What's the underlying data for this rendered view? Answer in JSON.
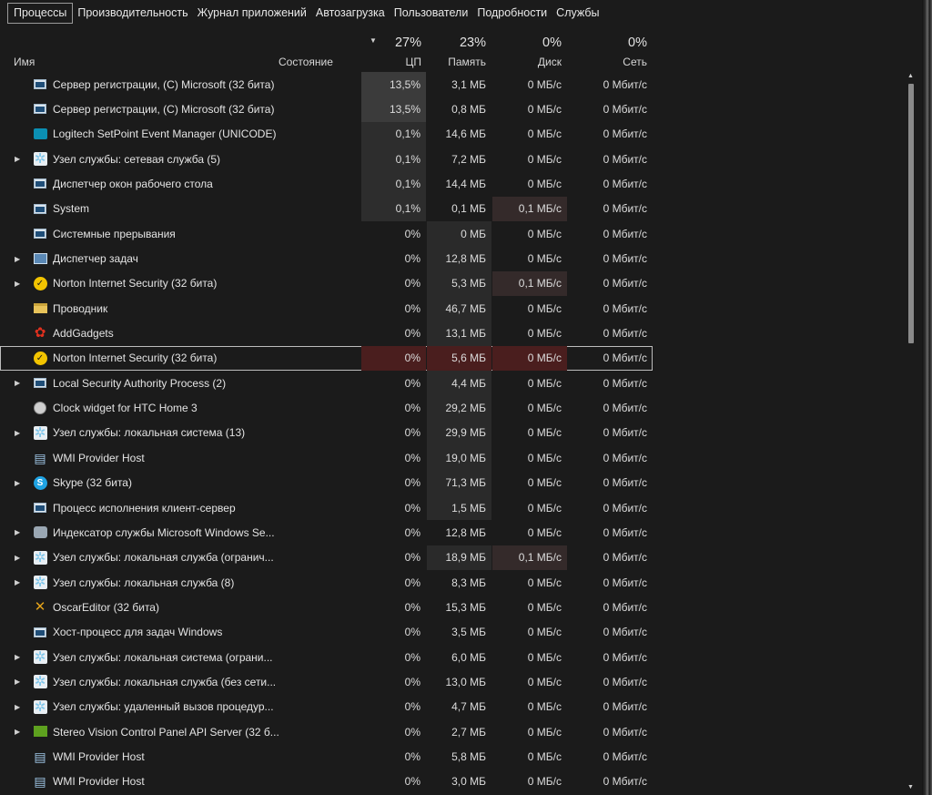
{
  "tabs": [
    "Процессы",
    "Производительность",
    "Журнал приложений",
    "Автозагрузка",
    "Пользователи",
    "Подробности",
    "Службы"
  ],
  "columns": {
    "name": "Имя",
    "status": "Состояние",
    "cpu": {
      "pct": "27%",
      "label": "ЦП"
    },
    "mem": {
      "pct": "23%",
      "label": "Память"
    },
    "disk": {
      "pct": "0%",
      "label": "Диск"
    },
    "net": {
      "pct": "0%",
      "label": "Сеть"
    }
  },
  "rows": [
    {
      "name": "Сервер регистрации, (C) Microsoft (32 бита)",
      "icon": "window-icon",
      "expand": false,
      "cpu": "13,5%",
      "mem": "3,1 МБ",
      "disk": "0 МБ/с",
      "net": "0 Мбит/с"
    },
    {
      "name": "Сервер регистрации, (C) Microsoft (32 бита)",
      "icon": "window-icon",
      "expand": false,
      "cpu": "13,5%",
      "mem": "0,8 МБ",
      "disk": "0 МБ/с",
      "net": "0 Мбит/с"
    },
    {
      "name": "Logitech SetPoint Event Manager (UNICODE)",
      "icon": "logitech-icon",
      "expand": false,
      "cpu": "0,1%",
      "mem": "14,6 МБ",
      "disk": "0 МБ/с",
      "net": "0 Мбит/с"
    },
    {
      "name": "Узел службы: сетевая служба (5)",
      "icon": "gear-icon",
      "expand": true,
      "cpu": "0,1%",
      "mem": "7,2 МБ",
      "disk": "0 МБ/с",
      "net": "0 Мбит/с"
    },
    {
      "name": "Диспетчер окон рабочего стола",
      "icon": "window-icon",
      "expand": false,
      "cpu": "0,1%",
      "mem": "14,4 МБ",
      "disk": "0 МБ/с",
      "net": "0 Мбит/с"
    },
    {
      "name": "System",
      "icon": "window-icon",
      "expand": false,
      "cpu": "0,1%",
      "mem": "0,1 МБ",
      "disk": "0,1 МБ/с",
      "net": "0 Мбит/с"
    },
    {
      "name": "Системные прерывания",
      "icon": "window-icon",
      "expand": false,
      "cpu": "0%",
      "mem": "0 МБ",
      "disk": "0 МБ/с",
      "net": "0 Мбит/с"
    },
    {
      "name": "Диспетчер задач",
      "icon": "task-manager-icon",
      "expand": true,
      "cpu": "0%",
      "mem": "12,8 МБ",
      "disk": "0 МБ/с",
      "net": "0 Мбит/с"
    },
    {
      "name": "Norton Internet Security (32 бита)",
      "icon": "norton-icon",
      "expand": true,
      "cpu": "0%",
      "mem": "5,3 МБ",
      "disk": "0,1 МБ/с",
      "net": "0 Мбит/с"
    },
    {
      "name": "Проводник",
      "icon": "folder-icon",
      "expand": false,
      "cpu": "0%",
      "mem": "46,7 МБ",
      "disk": "0 МБ/с",
      "net": "0 Мбит/с"
    },
    {
      "name": "AddGadgets",
      "icon": "huawei-icon",
      "expand": false,
      "cpu": "0%",
      "mem": "13,1 МБ",
      "disk": "0 МБ/с",
      "net": "0 Мбит/с"
    },
    {
      "name": "Norton Internet Security (32 бита)",
      "icon": "norton-icon",
      "expand": false,
      "cpu": "0%",
      "mem": "5,6 МБ",
      "disk": "0 МБ/с",
      "net": "0 Мбит/с",
      "selected": true
    },
    {
      "name": "Local Security Authority Process (2)",
      "icon": "window-icon",
      "expand": true,
      "cpu": "0%",
      "mem": "4,4 МБ",
      "disk": "0 МБ/с",
      "net": "0 Мбит/с"
    },
    {
      "name": "Clock widget for HTC Home 3",
      "icon": "clock-icon",
      "expand": false,
      "cpu": "0%",
      "mem": "29,2 МБ",
      "disk": "0 МБ/с",
      "net": "0 Мбит/с"
    },
    {
      "name": "Узел службы: локальная система (13)",
      "icon": "gear-icon",
      "expand": true,
      "cpu": "0%",
      "mem": "29,9 МБ",
      "disk": "0 МБ/с",
      "net": "0 Мбит/с"
    },
    {
      "name": "WMI Provider Host",
      "icon": "wmi-icon",
      "expand": false,
      "cpu": "0%",
      "mem": "19,0 МБ",
      "disk": "0 МБ/с",
      "net": "0 Мбит/с"
    },
    {
      "name": "Skype (32 бита)",
      "icon": "skype-icon",
      "expand": true,
      "cpu": "0%",
      "mem": "71,3 МБ",
      "disk": "0 МБ/с",
      "net": "0 Мбит/с"
    },
    {
      "name": "Процесс исполнения клиент-сервер",
      "icon": "window-icon",
      "expand": false,
      "cpu": "0%",
      "mem": "1,5 МБ",
      "disk": "0 МБ/с",
      "net": "0 Мбит/с"
    },
    {
      "name": "Индексатор службы Microsoft Windows Se...",
      "icon": "indexer-icon",
      "expand": true,
      "cpu": "0%",
      "mem": "12,8 МБ",
      "disk": "0 МБ/с",
      "net": "0 Мбит/с"
    },
    {
      "name": "Узел службы: локальная служба (огранич...",
      "icon": "gear-icon",
      "expand": true,
      "cpu": "0%",
      "mem": "18,9 МБ",
      "disk": "0,1 МБ/с",
      "net": "0 Мбит/с"
    },
    {
      "name": "Узел службы: локальная служба (8)",
      "icon": "gear-icon",
      "expand": true,
      "cpu": "0%",
      "mem": "8,3 МБ",
      "disk": "0 МБ/с",
      "net": "0 Мбит/с"
    },
    {
      "name": "OscarEditor (32 бита)",
      "icon": "oscar-icon",
      "expand": false,
      "cpu": "0%",
      "mem": "15,3 МБ",
      "disk": "0 МБ/с",
      "net": "0 Мбит/с"
    },
    {
      "name": "Хост-процесс для задач Windows",
      "icon": "window-icon",
      "expand": false,
      "cpu": "0%",
      "mem": "3,5 МБ",
      "disk": "0 МБ/с",
      "net": "0 Мбит/с"
    },
    {
      "name": "Узел службы: локальная система (ограни...",
      "icon": "gear-icon",
      "expand": true,
      "cpu": "0%",
      "mem": "6,0 МБ",
      "disk": "0 МБ/с",
      "net": "0 Мбит/с"
    },
    {
      "name": "Узел службы: локальная служба (без сети...",
      "icon": "gear-icon",
      "expand": true,
      "cpu": "0%",
      "mem": "13,0 МБ",
      "disk": "0 МБ/с",
      "net": "0 Мбит/с"
    },
    {
      "name": "Узел службы: удаленный вызов процедур...",
      "icon": "gear-icon",
      "expand": true,
      "cpu": "0%",
      "mem": "4,7 МБ",
      "disk": "0 МБ/с",
      "net": "0 Мбит/с"
    },
    {
      "name": "Stereo Vision Control Panel API Server (32 б...",
      "icon": "nvidia-icon",
      "expand": true,
      "cpu": "0%",
      "mem": "2,7 МБ",
      "disk": "0 МБ/с",
      "net": "0 Мбит/с"
    },
    {
      "name": "WMI Provider Host",
      "icon": "wmi-icon",
      "expand": false,
      "cpu": "0%",
      "mem": "5,8 МБ",
      "disk": "0 МБ/с",
      "net": "0 Мбит/с"
    },
    {
      "name": "WMI Provider Host",
      "icon": "wmi-icon",
      "expand": false,
      "cpu": "0%",
      "mem": "3,0 МБ",
      "disk": "0 МБ/с",
      "net": "0 Мбит/с"
    }
  ]
}
